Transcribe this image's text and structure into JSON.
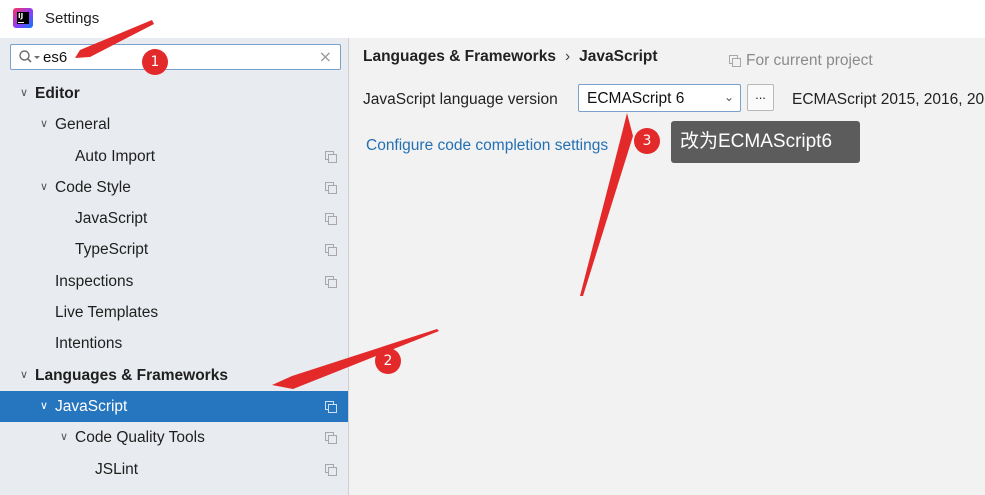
{
  "window": {
    "title": "Settings"
  },
  "search": {
    "value": "es6"
  },
  "tree": [
    {
      "label": "Editor",
      "level": 0,
      "bold": true,
      "expanded": true,
      "copy_icon": false,
      "selected": false
    },
    {
      "label": "General",
      "level": 1,
      "bold": false,
      "expanded": true,
      "copy_icon": false,
      "selected": false
    },
    {
      "label": "Auto Import",
      "level": 2,
      "bold": false,
      "expanded": null,
      "copy_icon": true,
      "selected": false
    },
    {
      "label": "Code Style",
      "level": 1,
      "bold": false,
      "expanded": true,
      "copy_icon": true,
      "selected": false
    },
    {
      "label": "JavaScript",
      "level": 2,
      "bold": false,
      "expanded": null,
      "copy_icon": true,
      "selected": false
    },
    {
      "label": "TypeScript",
      "level": 2,
      "bold": false,
      "expanded": null,
      "copy_icon": true,
      "selected": false
    },
    {
      "label": "Inspections",
      "level": 1,
      "bold": false,
      "expanded": null,
      "copy_icon": true,
      "selected": false
    },
    {
      "label": "Live Templates",
      "level": 1,
      "bold": false,
      "expanded": null,
      "copy_icon": false,
      "selected": false
    },
    {
      "label": "Intentions",
      "level": 1,
      "bold": false,
      "expanded": null,
      "copy_icon": false,
      "selected": false
    },
    {
      "label": "Languages & Frameworks",
      "level": 0,
      "bold": true,
      "expanded": true,
      "copy_icon": false,
      "selected": false
    },
    {
      "label": "JavaScript",
      "level": 1,
      "bold": false,
      "expanded": true,
      "copy_icon": true,
      "selected": true
    },
    {
      "label": "Code Quality Tools",
      "level": 2,
      "bold": false,
      "expanded": true,
      "copy_icon": true,
      "selected": false
    },
    {
      "label": "JSLint",
      "level": 3,
      "bold": false,
      "expanded": null,
      "copy_icon": true,
      "selected": false
    }
  ],
  "main": {
    "breadcrumb": {
      "parent": "Languages & Frameworks",
      "separator": "›",
      "current": "JavaScript"
    },
    "scope_label": "For current project",
    "language_version_label": "JavaScript language version",
    "language_version_value": "ECMAScript 6",
    "more_button_label": "...",
    "language_version_description": "ECMAScript 2015, 2016, 20",
    "config_link": "Configure code completion settings"
  },
  "annotations": {
    "tooltip_text": "改为ECMAScript6",
    "badges": [
      "1",
      "2",
      "3"
    ],
    "accent_color": "#e3292a"
  },
  "colors": {
    "selection": "#2675bf",
    "link": "#2470b3",
    "sidebar_bg": "#e8ebef"
  }
}
